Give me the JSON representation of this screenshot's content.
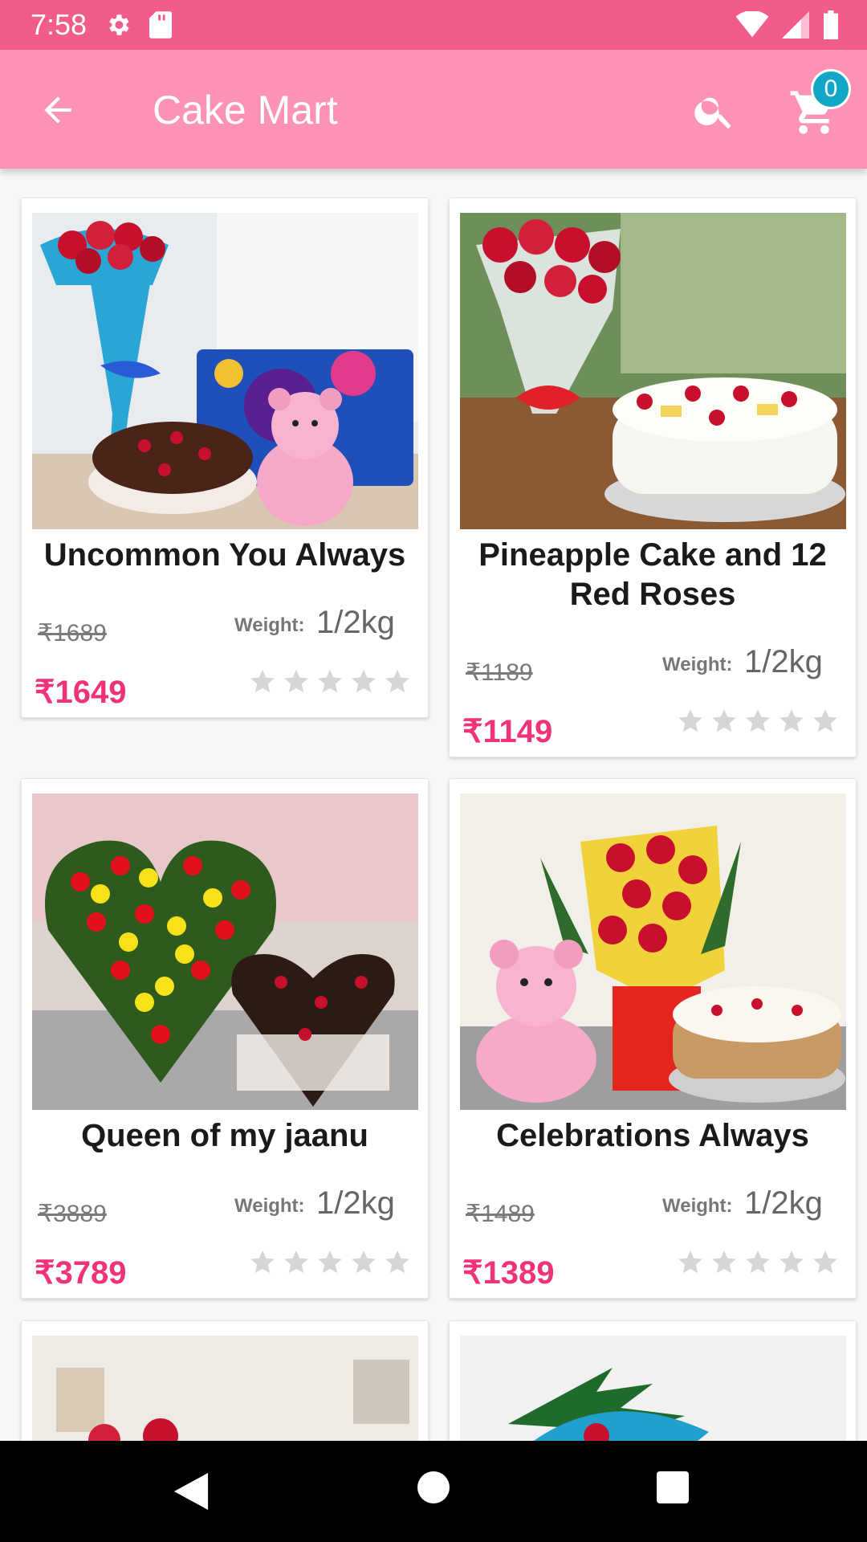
{
  "status_bar": {
    "time": "7:58"
  },
  "app_bar": {
    "title": "Cake Mart",
    "cart_count": "0"
  },
  "products": [
    {
      "name": "Uncommon You Always",
      "old_price": "₹1689",
      "price": "₹1649",
      "weight_label": "Weight:",
      "weight": "1/2kg",
      "rating": 0,
      "image": "roses-cake-teddy-chocolates-photo"
    },
    {
      "name": "Pineapple Cake and 12 Red Roses",
      "old_price": "₹1189",
      "price": "₹1149",
      "weight_label": "Weight:",
      "weight": "1/2kg",
      "rating": 0,
      "image": "roses-pineapple-cake-photo"
    },
    {
      "name": "Queen of my jaanu",
      "old_price": "₹3889",
      "price": "₹3789",
      "weight_label": "Weight:",
      "weight": "1/2kg",
      "rating": 0,
      "image": "heart-roses-chocolate-cake-photo"
    },
    {
      "name": "Celebrations Always",
      "old_price": "₹1489",
      "price": "₹1389",
      "weight_label": "Weight:",
      "weight": "1/2kg",
      "rating": 0,
      "image": "teddy-roses-butterscotch-cake-photo"
    }
  ],
  "colors": {
    "status_bar": "#f25c8a",
    "app_bar": "#fc93b6",
    "price": "#f0327a",
    "badge": "#12a7c7",
    "star": "#d6d6d6"
  }
}
